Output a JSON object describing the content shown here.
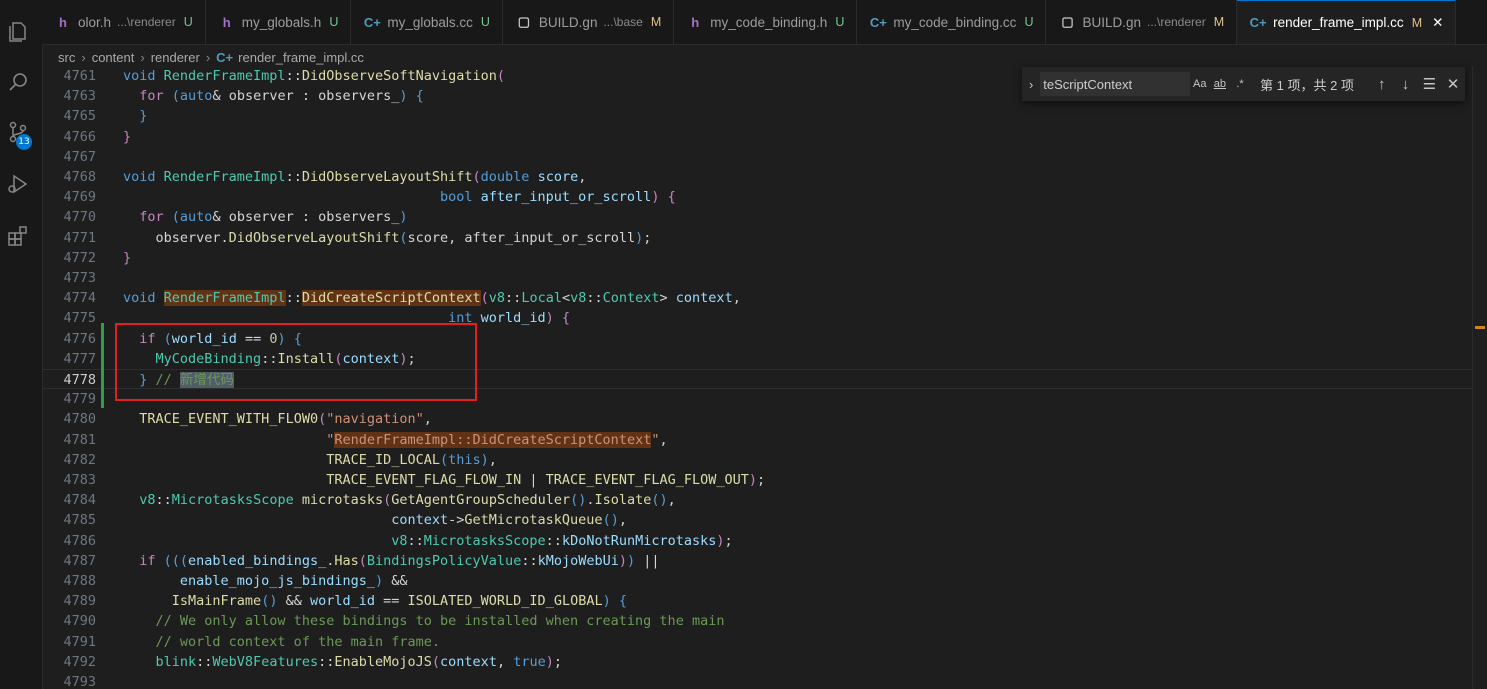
{
  "tabs": [
    {
      "name": "olor.h",
      "dir": "...\\renderer",
      "status": "U",
      "icon": "h",
      "active": false
    },
    {
      "name": "my_globals.h",
      "dir": "",
      "status": "U",
      "icon": "h",
      "active": false
    },
    {
      "name": "my_globals.cc",
      "dir": "",
      "status": "U",
      "icon": "cc",
      "active": false
    },
    {
      "name": "BUILD.gn",
      "dir": "...\\base",
      "status": "M",
      "icon": "doc",
      "active": false
    },
    {
      "name": "my_code_binding.h",
      "dir": "",
      "status": "U",
      "icon": "h",
      "active": false
    },
    {
      "name": "my_code_binding.cc",
      "dir": "",
      "status": "U",
      "icon": "cc",
      "active": false
    },
    {
      "name": "BUILD.gn",
      "dir": "...\\renderer",
      "status": "M",
      "icon": "doc",
      "active": false
    },
    {
      "name": "render_frame_impl.cc",
      "dir": "",
      "status": "M",
      "icon": "cc",
      "active": true
    }
  ],
  "breadcrumb": {
    "parts": [
      "src",
      "content",
      "renderer"
    ],
    "file": "render_frame_impl.cc"
  },
  "source_control_badge": "13",
  "find": {
    "query": "teScriptContext",
    "match_case": "Aa",
    "whole_word": "ab",
    "regex": ".*",
    "result": "第 1 项，共 2 项"
  },
  "lines": [
    {
      "n": "4761",
      "code": [
        [
          "k",
          "void "
        ],
        [
          "t",
          "RenderFrameImpl"
        ],
        [
          "",
          "::"
        ],
        [
          "f",
          "DidObserveSoftNavigation"
        ],
        [
          "c",
          "("
        ]
      ]
    },
    {
      "n": "4763",
      "code": [
        [
          "",
          "  "
        ],
        [
          "c",
          "for "
        ],
        [
          "k",
          "("
        ],
        [
          "k",
          "auto"
        ],
        [
          "",
          "& observer : observers_"
        ],
        [
          "k",
          ") {"
        ]
      ]
    },
    {
      "n": "4765",
      "code": [
        [
          "",
          "  "
        ],
        [
          "k",
          "}"
        ]
      ]
    },
    {
      "n": "4766",
      "code": [
        [
          "c",
          "}"
        ]
      ]
    },
    {
      "n": "4767",
      "code": []
    },
    {
      "n": "4768",
      "code": [
        [
          "k",
          "void "
        ],
        [
          "t",
          "RenderFrameImpl"
        ],
        [
          "",
          "::"
        ],
        [
          "f",
          "DidObserveLayoutShift"
        ],
        [
          "c",
          "("
        ],
        [
          "k",
          "double "
        ],
        [
          "v",
          "score"
        ],
        [
          "",
          ","
        ]
      ]
    },
    {
      "n": "4769",
      "code": [
        [
          "",
          "                                       "
        ],
        [
          "k",
          "bool "
        ],
        [
          "v",
          "after_input_or_scroll"
        ],
        [
          "c",
          ") {"
        ]
      ]
    },
    {
      "n": "4770",
      "code": [
        [
          "",
          "  "
        ],
        [
          "c",
          "for "
        ],
        [
          "k",
          "("
        ],
        [
          "k",
          "auto"
        ],
        [
          "",
          "& observer : observers_"
        ],
        [
          "k",
          ")"
        ]
      ]
    },
    {
      "n": "4771",
      "code": [
        [
          "",
          "    observer."
        ],
        [
          "f",
          "DidObserveLayoutShift"
        ],
        [
          "k",
          "("
        ],
        [
          "",
          "score, after_input_or_scroll"
        ],
        [
          "k",
          ")"
        ],
        [
          "",
          ";"
        ]
      ]
    },
    {
      "n": "4772",
      "code": [
        [
          "c",
          "}"
        ]
      ]
    },
    {
      "n": "4773",
      "code": []
    },
    {
      "n": "4774",
      "code": [
        [
          "k",
          "void "
        ],
        [
          "t",
          "RenderFrameImpl"
        ],
        [
          "",
          "::"
        ],
        [
          "f",
          "DidCreateScriptContext"
        ],
        [
          "c",
          "("
        ],
        [
          "t",
          "v8"
        ],
        [
          "",
          "::"
        ],
        [
          "t",
          "Local"
        ],
        [
          "",
          "<"
        ],
        [
          "t",
          "v8"
        ],
        [
          "",
          "::"
        ],
        [
          "t",
          "Context"
        ],
        [
          "",
          "> "
        ],
        [
          "v",
          "context"
        ],
        [
          "",
          ","
        ]
      ]
    },
    {
      "n": "4775",
      "code": [
        [
          "",
          "                                        "
        ],
        [
          "k",
          "int "
        ],
        [
          "v",
          "world_id"
        ],
        [
          "c",
          ") {"
        ]
      ]
    },
    {
      "n": "4776",
      "code": [
        [
          "",
          "  "
        ],
        [
          "c",
          "if "
        ],
        [
          "k",
          "("
        ],
        [
          "v",
          "world_id"
        ],
        [
          "",
          " == "
        ],
        [
          "n",
          "0"
        ],
        [
          "k",
          ") {"
        ]
      ]
    },
    {
      "n": "4777",
      "code": [
        [
          "",
          "    "
        ],
        [
          "t",
          "MyCodeBinding"
        ],
        [
          "",
          "::"
        ],
        [
          "f",
          "Install"
        ],
        [
          "c",
          "("
        ],
        [
          "v",
          "context"
        ],
        [
          "c",
          ")"
        ],
        [
          "",
          ";"
        ]
      ]
    },
    {
      "n": "4778",
      "code": [
        [
          "",
          "  "
        ],
        [
          "k",
          "} "
        ],
        [
          "cm",
          "// "
        ],
        [
          "cm",
          "新增代码"
        ]
      ]
    },
    {
      "n": "4779",
      "code": []
    },
    {
      "n": "4780",
      "code": [
        [
          "",
          "  "
        ],
        [
          "m",
          "TRACE_EVENT_WITH_FLOW0"
        ],
        [
          "c",
          "("
        ],
        [
          "s",
          "\"navigation\""
        ],
        [
          "",
          ","
        ]
      ]
    },
    {
      "n": "4781",
      "code": [
        [
          "",
          "                         "
        ],
        [
          "s",
          "\""
        ],
        [
          "s",
          "RenderFrameImpl::DidCreateScriptContext"
        ],
        [
          "s",
          "\""
        ],
        [
          "",
          ","
        ]
      ]
    },
    {
      "n": "4782",
      "code": [
        [
          "",
          "                         "
        ],
        [
          "m",
          "TRACE_ID_LOCAL"
        ],
        [
          "k",
          "("
        ],
        [
          "k",
          "this"
        ],
        [
          "k",
          ")"
        ],
        [
          "",
          ","
        ]
      ]
    },
    {
      "n": "4783",
      "code": [
        [
          "",
          "                         "
        ],
        [
          "m",
          "TRACE_EVENT_FLAG_FLOW_IN"
        ],
        [
          "",
          " | "
        ],
        [
          "m",
          "TRACE_EVENT_FLAG_FLOW_OUT"
        ],
        [
          "c",
          ")"
        ],
        [
          "",
          ";"
        ]
      ]
    },
    {
      "n": "4784",
      "code": [
        [
          "",
          "  "
        ],
        [
          "t",
          "v8"
        ],
        [
          "",
          "::"
        ],
        [
          "t",
          "MicrotasksScope"
        ],
        [
          "",
          " "
        ],
        [
          "f",
          "microtasks"
        ],
        [
          "c",
          "("
        ],
        [
          "f",
          "GetAgentGroupScheduler"
        ],
        [
          "k",
          "()"
        ],
        [
          "",
          "."
        ],
        [
          "f",
          "Isolate"
        ],
        [
          "k",
          "()"
        ],
        [
          "",
          ","
        ]
      ]
    },
    {
      "n": "4785",
      "code": [
        [
          "",
          "                                 "
        ],
        [
          "v",
          "context"
        ],
        [
          "",
          "->"
        ],
        [
          "f",
          "GetMicrotaskQueue"
        ],
        [
          "k",
          "()"
        ],
        [
          "",
          ","
        ]
      ]
    },
    {
      "n": "4786",
      "code": [
        [
          "",
          "                                 "
        ],
        [
          "t",
          "v8"
        ],
        [
          "",
          "::"
        ],
        [
          "t",
          "MicrotasksScope"
        ],
        [
          "",
          "::"
        ],
        [
          "v",
          "kDoNotRunMicrotasks"
        ],
        [
          "c",
          ")"
        ],
        [
          "",
          ";"
        ]
      ]
    },
    {
      "n": "4787",
      "code": [
        [
          "",
          "  "
        ],
        [
          "c",
          "if "
        ],
        [
          "k",
          "((("
        ],
        [
          "v",
          "enabled_bindings_"
        ],
        [
          "",
          "."
        ],
        [
          "f",
          "Has"
        ],
        [
          "c",
          "("
        ],
        [
          "t",
          "BindingsPolicyValue"
        ],
        [
          "",
          "::"
        ],
        [
          "v",
          "kMojoWebUi"
        ],
        [
          "c",
          ")"
        ],
        [
          "k",
          ")"
        ],
        [
          "",
          " ||"
        ]
      ]
    },
    {
      "n": "4788",
      "code": [
        [
          "",
          "       "
        ],
        [
          "v",
          "enable_mojo_js_bindings_"
        ],
        [
          "k",
          ")"
        ],
        [
          "",
          " &&"
        ]
      ]
    },
    {
      "n": "4789",
      "code": [
        [
          "",
          "      "
        ],
        [
          "f",
          "IsMainFrame"
        ],
        [
          "k",
          "()"
        ],
        [
          "",
          " && "
        ],
        [
          "v",
          "world_id"
        ],
        [
          "",
          " == "
        ],
        [
          "m",
          "ISOLATED_WORLD_ID_GLOBAL"
        ],
        [
          "k",
          ") {"
        ]
      ]
    },
    {
      "n": "4790",
      "code": [
        [
          "",
          "    "
        ],
        [
          "cm",
          "// We only allow these bindings to be installed when creating the main"
        ]
      ]
    },
    {
      "n": "4791",
      "code": [
        [
          "",
          "    "
        ],
        [
          "cm",
          "// world context of the main frame."
        ]
      ]
    },
    {
      "n": "4792",
      "code": [
        [
          "",
          "    "
        ],
        [
          "t",
          "blink"
        ],
        [
          "",
          "::"
        ],
        [
          "t",
          "WebV8Features"
        ],
        [
          "",
          "::"
        ],
        [
          "f",
          "EnableMojoJS"
        ],
        [
          "c",
          "("
        ],
        [
          "v",
          "context"
        ],
        [
          "",
          ", "
        ],
        [
          "k",
          "true"
        ],
        [
          "c",
          ")"
        ],
        [
          "",
          ";"
        ]
      ]
    },
    {
      "n": "4793",
      "code": []
    }
  ]
}
